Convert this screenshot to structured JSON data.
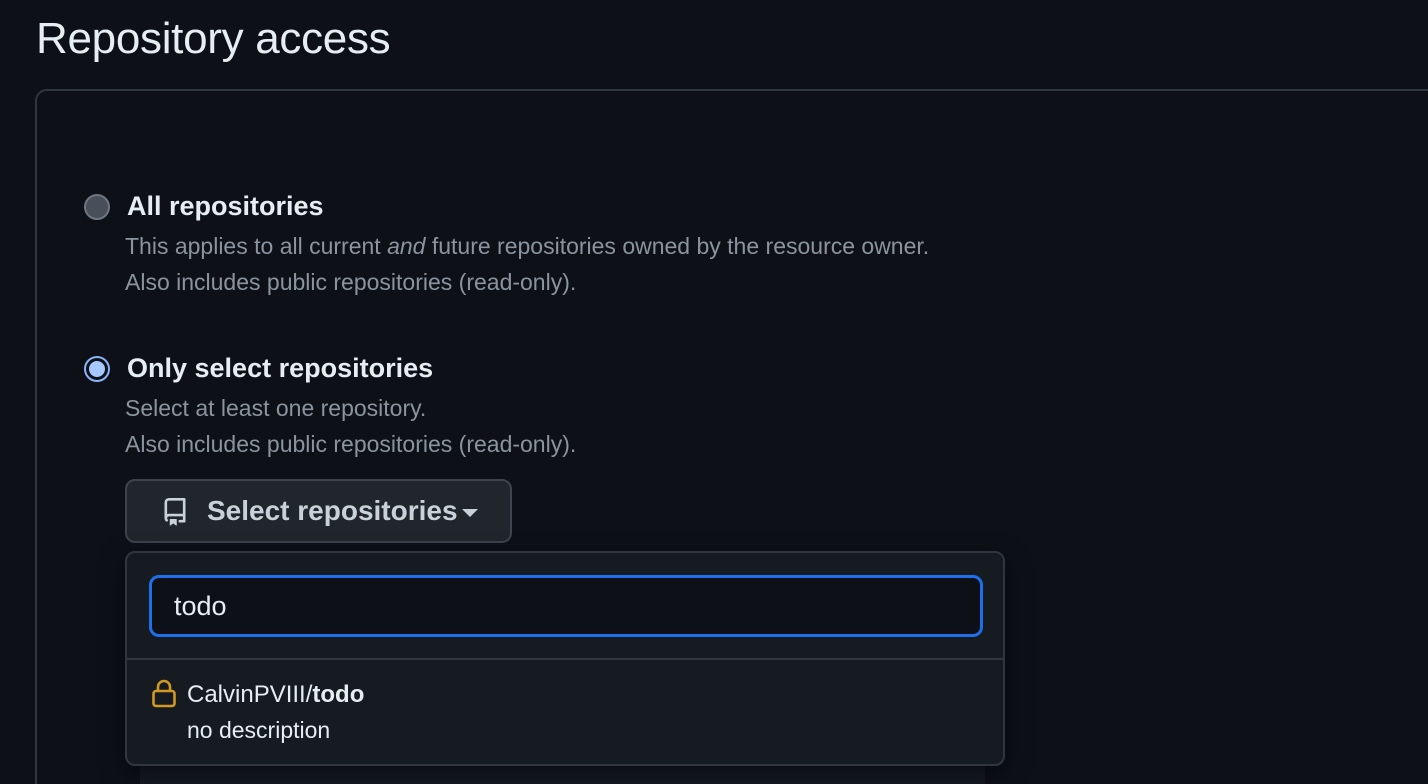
{
  "page": {
    "title": "Repository access"
  },
  "options": {
    "all": {
      "label": "All repositories",
      "desc_prefix": "This applies to all current ",
      "desc_emphasis": "and",
      "desc_suffix": " future repositories owned by the resource owner.",
      "desc_line2": "Also includes public repositories (read-only).",
      "checked": false
    },
    "select": {
      "label": "Only select repositories",
      "desc_line1": "Select at least one repository.",
      "desc_line2": "Also includes public repositories (read-only).",
      "checked": true
    }
  },
  "select_button": {
    "label": "Select repositories",
    "icon": "repo-icon"
  },
  "dropdown": {
    "search_value": "todo",
    "results": [
      {
        "owner": "CalvinPVIII/",
        "name": "todo",
        "description": "no description",
        "icon": "lock-icon"
      }
    ]
  },
  "colors": {
    "background": "#0d1117",
    "accent": "#1f6feb",
    "lock": "#d29922"
  }
}
